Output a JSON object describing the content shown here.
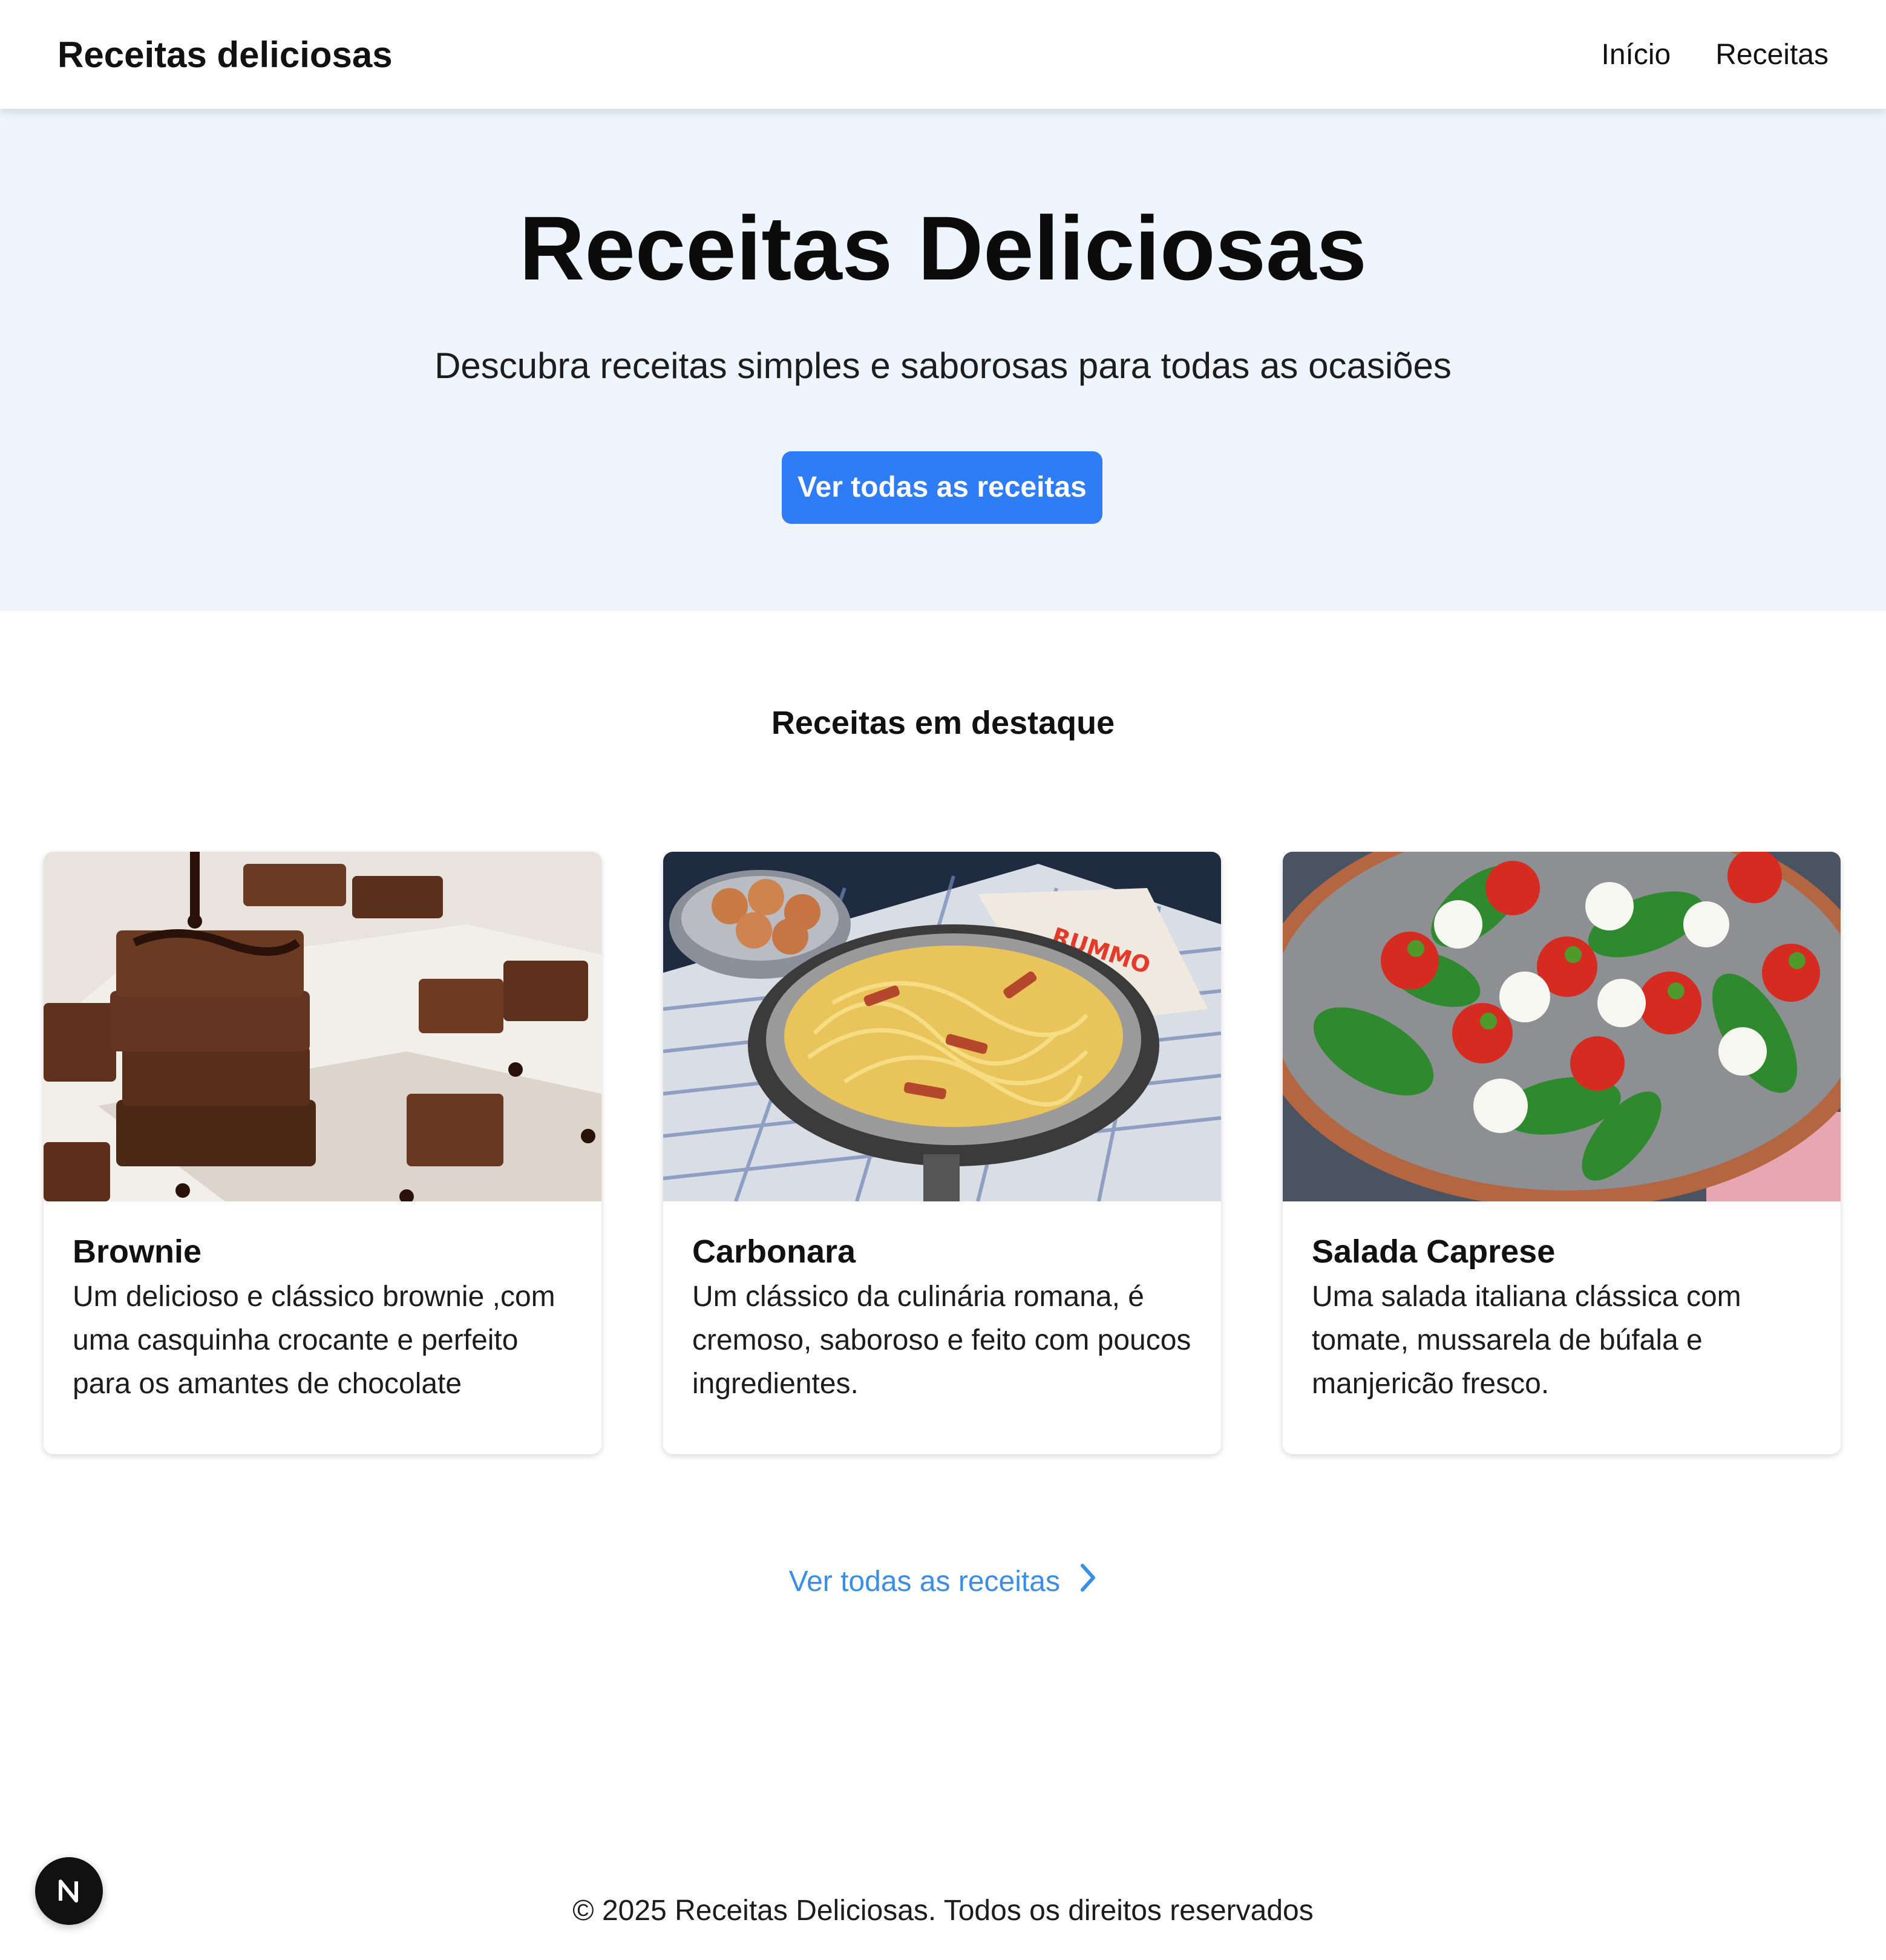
{
  "header": {
    "brand": "Receitas deliciosas",
    "nav": [
      "Início",
      "Receitas"
    ]
  },
  "hero": {
    "title": "Receitas Deliciosas",
    "subtitle": "Descubra receitas simples e saborosas para todas as ocasiões",
    "cta_label": "Ver todas as receitas"
  },
  "featured": {
    "title": "Receitas em destaque",
    "cards": [
      {
        "title": "Brownie",
        "description": "Um delicioso e clássico brownie ,com uma casquinha crocante e perfeito para os amantes de chocolate",
        "image": "brownie-photo"
      },
      {
        "title": "Carbonara",
        "description": "Um clássico da culinária romana, é cremoso, saboroso e feito com poucos ingredientes.",
        "image": "carbonara-photo"
      },
      {
        "title": "Salada Caprese",
        "description": "Uma salada italiana clássica com tomate, mussarela de búfala e manjericão fresco.",
        "image": "caprese-salad-photo"
      }
    ],
    "all_link": "Ver todas as receitas"
  },
  "footer": {
    "copyright": "© 2025 Receitas Deliciosas. Todos os direitos reservados"
  },
  "colors": {
    "primary": "#2f7df6",
    "link": "#3b8ee6",
    "hero_bg": "#eef5ff"
  }
}
